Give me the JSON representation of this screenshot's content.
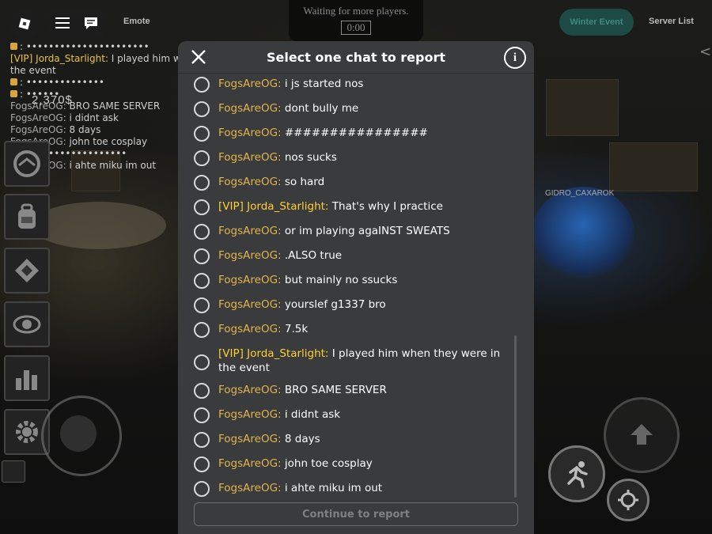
{
  "hud": {
    "emote_label": "Emote",
    "winter_event_label": "Winter Event",
    "server_list_label": "Server List",
    "waiting_text": "Waiting for more players.",
    "timer": "0:00",
    "player_tag": "GIDRO_CAXAROK"
  },
  "background_chat": [
    {
      "sender": "",
      "text": ": ••••••••••••••••••••••",
      "locked": true
    },
    {
      "sender": "[VIP] Jorda_Starlight:",
      "text": " I played him whe",
      "vip": true
    },
    {
      "sender": "",
      "text": "the event"
    },
    {
      "sender": "",
      "text": ": ••••••••••••••",
      "locked": true
    },
    {
      "sender": "",
      "text": ": ••••••",
      "locked": true
    },
    {
      "sender": "FogsAreOG:",
      "text": " BRO SAME SERVER"
    },
    {
      "sender": "FogsAreOG:",
      "text": " i didnt ask"
    },
    {
      "sender": "FogsAreOG:",
      "text": " 8 days"
    },
    {
      "sender": "FogsAreOG:",
      "text": " john toe cosplay"
    },
    {
      "sender": "",
      "text": ": ••••••••••••••••••",
      "locked": true
    },
    {
      "sender": "FogsAreOG:",
      "text": " i ahte miku im out"
    }
  ],
  "money_text": "2,370$",
  "modal": {
    "title": "Select one chat to report",
    "info_glyph": "i",
    "continue_label": "Continue to report",
    "messages": [
      {
        "sender": "FogsAreOG:",
        "text": "i js started nos",
        "vip": false
      },
      {
        "sender": "FogsAreOG:",
        "text": "dont bully  me",
        "vip": false
      },
      {
        "sender": "FogsAreOG:",
        "text": "################",
        "vip": false
      },
      {
        "sender": "FogsAreOG:",
        "text": "nos sucks",
        "vip": false
      },
      {
        "sender": "FogsAreOG:",
        "text": "so hard",
        "vip": false
      },
      {
        "sender": "[VIP] Jorda_Starlight:",
        "text": "That's why I practice",
        "vip": true
      },
      {
        "sender": "FogsAreOG:",
        "text": "or im playing agaINST SWEATS",
        "vip": false
      },
      {
        "sender": "FogsAreOG:",
        "text": ".ALSO true",
        "vip": false
      },
      {
        "sender": "FogsAreOG:",
        "text": "but mainly no ssucks",
        "vip": false
      },
      {
        "sender": "FogsAreOG:",
        "text": "yourslef g1337 bro",
        "vip": false
      },
      {
        "sender": "FogsAreOG:",
        "text": "7.5k",
        "vip": false
      },
      {
        "sender": "[VIP] Jorda_Starlight:",
        "text": "I played him when they were in the event",
        "vip": true
      },
      {
        "sender": "FogsAreOG:",
        "text": "BRO SAME SERVER",
        "vip": false
      },
      {
        "sender": "FogsAreOG:",
        "text": "i didnt ask",
        "vip": false
      },
      {
        "sender": "FogsAreOG:",
        "text": "8 days",
        "vip": false
      },
      {
        "sender": "FogsAreOG:",
        "text": "john toe cosplay",
        "vip": false
      },
      {
        "sender": "FogsAreOG:",
        "text": "i ahte miku im out",
        "vip": false
      }
    ]
  },
  "colors": {
    "modal_bg": "#393b3d",
    "sender_name": "#e2b44c",
    "vip_sender": "#ffcf33",
    "winter_event_bg": "#1e4a45"
  }
}
